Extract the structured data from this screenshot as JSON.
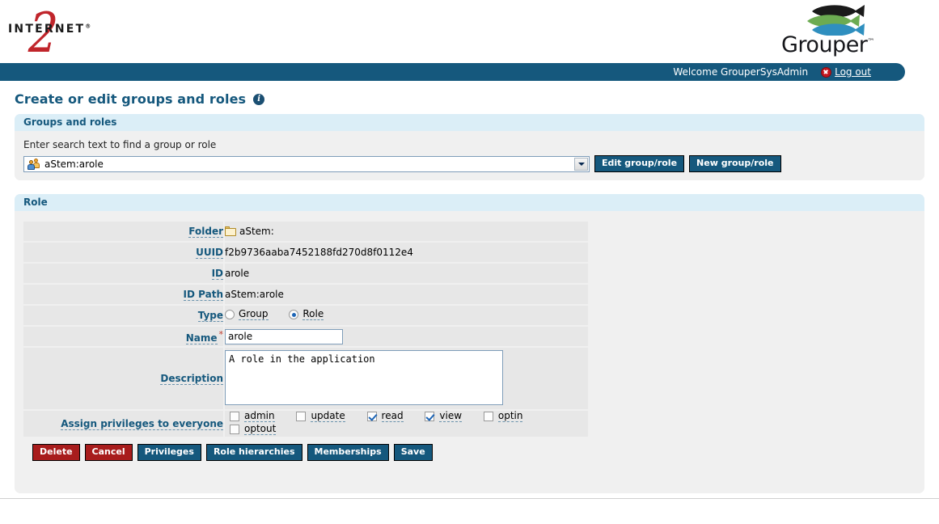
{
  "branding": {
    "internet2_word": "INTERNET",
    "internet2_reg": "®",
    "internet2_numeral": "2",
    "grouper_word": "Grouper",
    "grouper_tm": "™"
  },
  "welcome_bar": {
    "welcome_text": "Welcome GrouperSysAdmin",
    "logout_label": "Log out",
    "logout_icon": "delete-circle-icon",
    "background_color": "#15587d"
  },
  "page": {
    "title": "Create or edit groups and roles",
    "info_icon": "info-icon"
  },
  "groups_panel": {
    "header": "Groups and roles",
    "search_label": "Enter search text to find a group or role",
    "combobox": {
      "value": "aStem:arole",
      "placeholder": "Enter search text to find a group or role",
      "icon": "group-people-icon"
    },
    "buttons": [
      {
        "label": "Edit group/role",
        "style": "blue"
      },
      {
        "label": "New group/role",
        "style": "blue"
      }
    ]
  },
  "role_panel": {
    "header": "Role",
    "fields": {
      "folder_label": "Folder",
      "folder_value": "aStem:",
      "folder_icon": "folder-icon",
      "uuid_label": "UUID",
      "uuid_value": "f2b9736aaba7452188fd270d8f0112e4",
      "id_label": "ID",
      "id_value": "arole",
      "id_path_label": "ID Path",
      "id_path_value": "aStem:arole",
      "type_label": "Type",
      "name_label": "Name",
      "name_required_marker": "*",
      "name_value": "arole",
      "description_label": "Description",
      "description_value": "A role in the application",
      "privileges_label": "Assign privileges to everyone"
    },
    "type_options": [
      {
        "label": "Group",
        "selected": false
      },
      {
        "label": "Role",
        "selected": true
      }
    ],
    "privileges": [
      {
        "label": "admin",
        "checked": false
      },
      {
        "label": "update",
        "checked": false
      },
      {
        "label": "read",
        "checked": true
      },
      {
        "label": "view",
        "checked": true
      },
      {
        "label": "optin",
        "checked": false
      },
      {
        "label": "optout",
        "checked": false
      }
    ],
    "buttons": [
      {
        "label": "Delete",
        "style": "red"
      },
      {
        "label": "Cancel",
        "style": "red"
      },
      {
        "label": "Privileges",
        "style": "blue"
      },
      {
        "label": "Role hierarchies",
        "style": "blue"
      },
      {
        "label": "Memberships",
        "style": "blue"
      },
      {
        "label": "Save",
        "style": "blue"
      }
    ]
  },
  "colors": {
    "brand_blue": "#15587d",
    "panel_header_blue": "#dbeef7",
    "button_red": "#a81c1c",
    "internet2_red": "#c0252b",
    "row_gray": "#e7e7e7"
  }
}
